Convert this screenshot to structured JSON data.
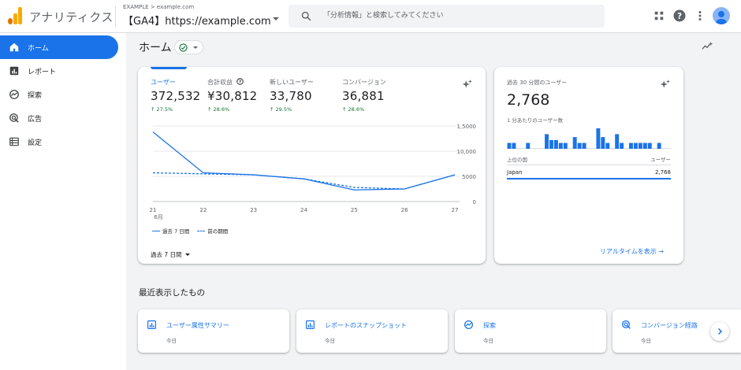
{
  "app": {
    "title": "アナリティクス",
    "breadcrumb": "EXAMPLE > example.com",
    "property": "【GA4】https://example.com"
  },
  "search": {
    "placeholder": "「分析情報」と検索してみてください"
  },
  "topbar_icons": [
    "apps-grid-icon",
    "help-icon",
    "more-vert-icon",
    "account-avatar-icon"
  ],
  "sidebar": {
    "items": [
      {
        "label": "ホーム",
        "icon": "home-icon",
        "active": true
      },
      {
        "label": "レポート",
        "icon": "bar-chart-icon",
        "active": false
      },
      {
        "label": "探索",
        "icon": "explore-icon",
        "active": false
      },
      {
        "label": "広告",
        "icon": "ads-target-icon",
        "active": false
      },
      {
        "label": "設定",
        "icon": "settings-list-icon",
        "active": false
      }
    ]
  },
  "page": {
    "title": "ホーム"
  },
  "overview": {
    "metrics": [
      {
        "label": "ユーザー",
        "value": "372,532",
        "delta": "↑ 27.5%"
      },
      {
        "label": "合計収益",
        "value": "¥30,812",
        "delta": "↑ 28.6%"
      },
      {
        "label": "新しいユーザー",
        "value": "33,780",
        "delta": "↑ 29.5%"
      },
      {
        "label": "コンバージョン",
        "value": "36,881",
        "delta": "↑ 28.6%"
      }
    ],
    "legend": {
      "current": "過去 7 日間",
      "previous": "前の期間"
    },
    "date_range": "過去 7 日間"
  },
  "chart_data": {
    "type": "line",
    "categories": [
      "21",
      "22",
      "23",
      "24",
      "25",
      "26",
      "27"
    ],
    "x_sublabel": "6月",
    "series": [
      {
        "name": "過去 7 日間",
        "style": "solid",
        "values": [
          13800,
          5700,
          5300,
          4500,
          2300,
          2500,
          5300
        ]
      },
      {
        "name": "前の期間",
        "style": "dashed",
        "values": [
          5700,
          5500,
          5300,
          4500,
          2800,
          2500,
          5300
        ]
      }
    ],
    "y_ticks": [
      0,
      5000,
      10000,
      15000
    ],
    "y_tick_labels": [
      "0",
      "5000",
      "10,000",
      "1,5000"
    ],
    "ylim": [
      0,
      15000
    ],
    "grid": true,
    "colors": {
      "line": "#1a73e8",
      "grid": "#e8eaed"
    }
  },
  "realtime": {
    "label": "過去 30 分間のユーザー",
    "value": "2,768",
    "sub_label": "1 分あたりのユーザー数",
    "per_minute": [
      2,
      2,
      0,
      0,
      2,
      0,
      0,
      0,
      5,
      3,
      3,
      2,
      2,
      0,
      4,
      2,
      2,
      0,
      0,
      7,
      4,
      2,
      0,
      5,
      2,
      0,
      2,
      2,
      2,
      2,
      2,
      0,
      2,
      0,
      0
    ],
    "table_header": {
      "country": "上位の国",
      "users": "ユーザー"
    },
    "rows": [
      {
        "country": "Japan",
        "users": "2,768"
      }
    ],
    "link": "リアルタイムを表示 →"
  },
  "recent": {
    "title": "最近表示したもの",
    "items": [
      {
        "title": "ユーザー属性サマリー",
        "sub": "今日",
        "icon": "report-icon"
      },
      {
        "title": "レポートのスナップショット",
        "sub": "今日",
        "icon": "report-icon"
      },
      {
        "title": "探索",
        "sub": "今日",
        "icon": "explore-icon"
      },
      {
        "title": "コンバージョン経路",
        "sub": "今日",
        "icon": "ads-target-icon"
      }
    ]
  },
  "colors": {
    "accent": "#1a73e8",
    "positive": "#137333",
    "logo_orange": "#f9ab00",
    "logo_dark_orange": "#e37400"
  }
}
